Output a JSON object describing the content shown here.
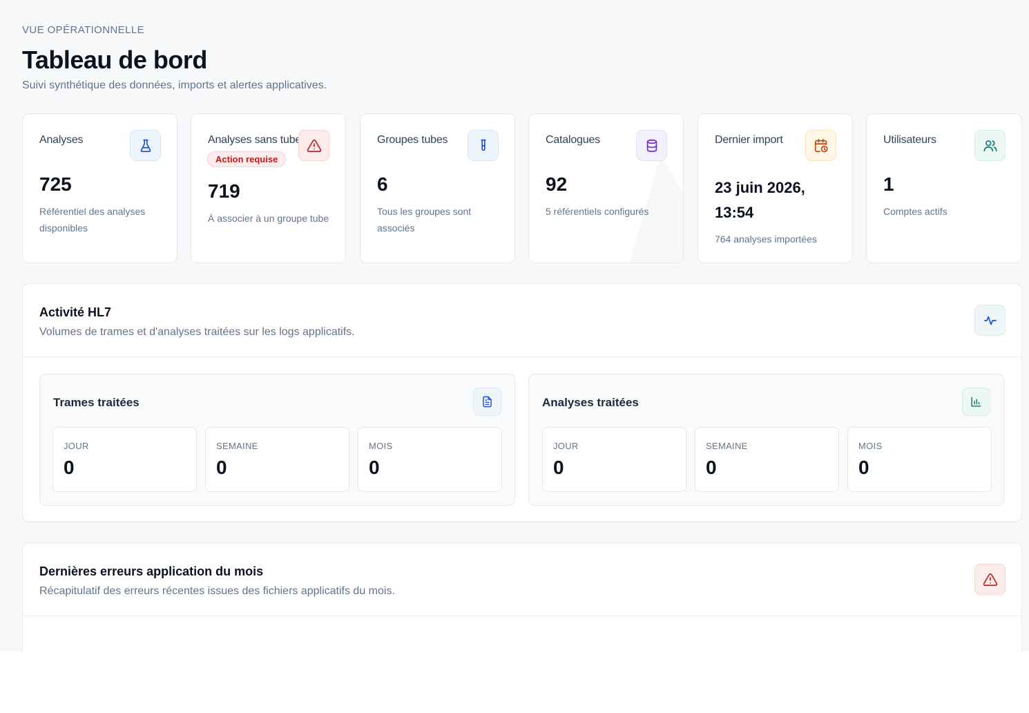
{
  "header": {
    "eyebrow": "VUE OPÉRATIONNELLE",
    "title": "Tableau de bord",
    "subtitle": "Suivi synthétique des données, imports et alertes applicatives."
  },
  "stats": [
    {
      "label": "Analyses",
      "value": "725",
      "description": "Référentiel des analyses disponibles",
      "icon": "flask-icon",
      "color": "#1d4ed8"
    },
    {
      "label": "Analyses sans tube",
      "badge": "Action requise",
      "value": "719",
      "description": "À associer à un groupe tube",
      "icon": "alert-triangle-icon",
      "color": "#c01c1c"
    },
    {
      "label": "Groupes tubes",
      "value": "6",
      "description": "Tous les groupes sont associés",
      "icon": "test-tube-icon",
      "color": "#1d4ed8"
    },
    {
      "label": "Catalogues",
      "value": "92",
      "description": "5 référentiels configurés",
      "icon": "database-icon",
      "color": "#6d28d9"
    },
    {
      "label": "Dernier import",
      "value": "23 juin 2026, 13:54",
      "description": "764 analyses importées",
      "icon": "calendar-clock-icon",
      "color": "#c2410c"
    },
    {
      "label": "Utilisateurs",
      "value": "1",
      "description": "Comptes actifs",
      "icon": "users-icon",
      "color": "#0f766e"
    }
  ],
  "hl7": {
    "title": "Activité HL7",
    "subtitle": "Volumes de trames et d'analyses traitées sur les logs applicatifs.",
    "icon": "activity-icon",
    "cards": [
      {
        "title": "Trames traitées",
        "icon": "file-text-icon",
        "metrics": [
          {
            "label": "JOUR",
            "value": "0"
          },
          {
            "label": "SEMAINE",
            "value": "0"
          },
          {
            "label": "MOIS",
            "value": "0"
          }
        ]
      },
      {
        "title": "Analyses traitées",
        "icon": "bar-chart-icon",
        "metrics": [
          {
            "label": "JOUR",
            "value": "0"
          },
          {
            "label": "SEMAINE",
            "value": "0"
          },
          {
            "label": "MOIS",
            "value": "0"
          }
        ]
      }
    ]
  },
  "errors": {
    "title": "Dernières erreurs application du mois",
    "subtitle": "Récapitulatif des erreurs récentes issues des fichiers applicatifs du mois.",
    "icon": "alert-triangle-icon"
  }
}
